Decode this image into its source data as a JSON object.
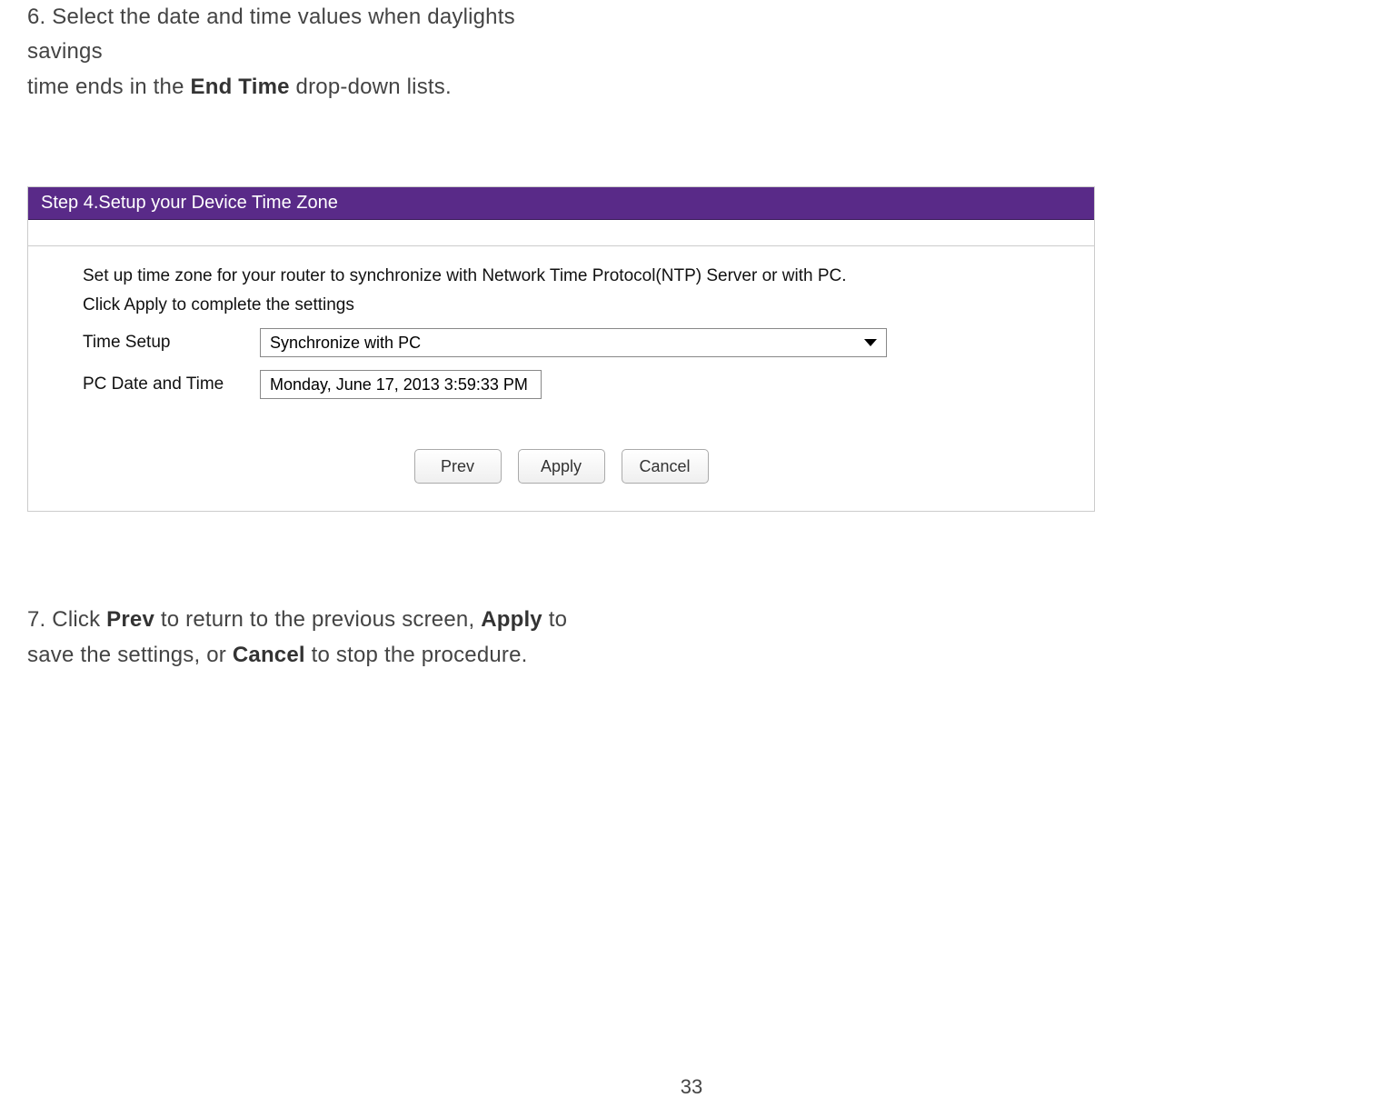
{
  "step6": {
    "line1": "6. Select the date and time values when daylights savings",
    "line2_pre": "time ends in the ",
    "line2_bold": "End Time",
    "line2_post": " drop-down lists."
  },
  "screenshot": {
    "header": "Step 4.Setup your Device Time Zone",
    "desc1": "Set up time zone for your router to synchronize with Network Time Protocol(NTP) Server or with PC.",
    "desc2": "Click Apply to complete the settings",
    "time_setup_label": "Time Setup",
    "time_setup_value": "Synchronize with PC",
    "pc_date_label": "PC Date and Time",
    "pc_date_value": "Monday, June 17, 2013 3:59:33 PM",
    "buttons": {
      "prev": "Prev",
      "apply": "Apply",
      "cancel": "Cancel"
    }
  },
  "step7": {
    "pre1": "7. Click ",
    "b1": "Prev",
    "mid1": " to return to the previous screen, ",
    "b2": "Apply",
    "post1": " to",
    "line2_pre": "save the settings, or ",
    "b3": "Cancel",
    "line2_post": " to stop the procedure."
  },
  "page_number": "33"
}
